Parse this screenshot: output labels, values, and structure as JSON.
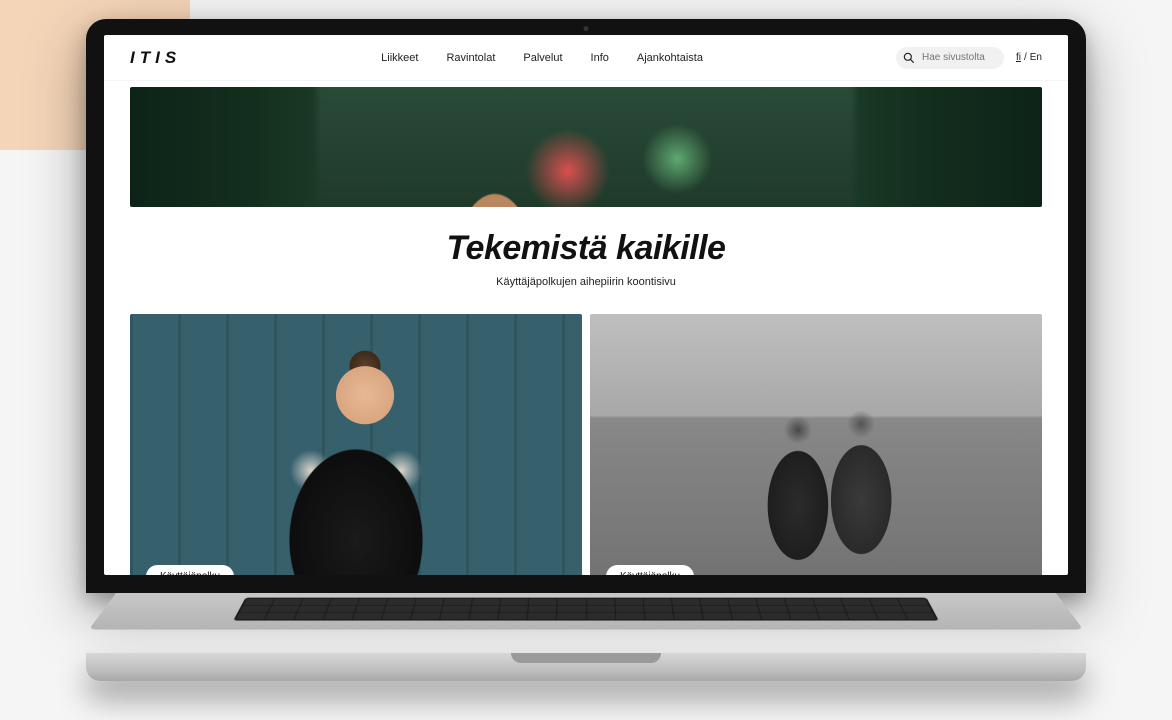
{
  "header": {
    "logo": "ITIS",
    "nav": [
      "Liikkeet",
      "Ravintolat",
      "Palvelut",
      "Info",
      "Ajankohtaista"
    ],
    "search_placeholder": "Hae sivustolta",
    "lang": {
      "active": "fi",
      "other": "En",
      "separator": "/"
    }
  },
  "main": {
    "title": "Tekemistä kaikille",
    "subtitle": "Käyttäjäpolkujen aihepiirin koontisivu"
  },
  "cards": [
    {
      "badge": "Käyttäjäpolku"
    },
    {
      "badge": "Käyttäjäpolku"
    }
  ]
}
